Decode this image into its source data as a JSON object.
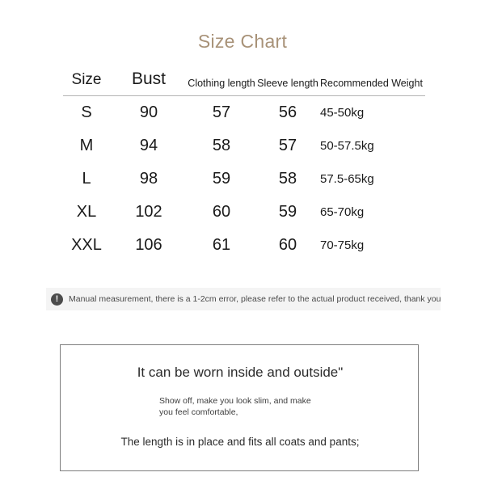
{
  "title": "Size Chart",
  "accent_color": "#a89278",
  "table": {
    "headers": {
      "size": "Size",
      "bust": "Bust",
      "clothing_length": "Clothing length",
      "sleeve_length": "Sleeve length",
      "recommended_weight": "Recommended Weight"
    },
    "rows": [
      {
        "size": "S",
        "bust": "90",
        "clothing_length": "57",
        "sleeve_length": "56",
        "recommended_weight": "45-50kg"
      },
      {
        "size": "M",
        "bust": "94",
        "clothing_length": "58",
        "sleeve_length": "57",
        "recommended_weight": "50-57.5kg"
      },
      {
        "size": "L",
        "bust": "98",
        "clothing_length": "59",
        "sleeve_length": "58",
        "recommended_weight": "57.5-65kg"
      },
      {
        "size": "XL",
        "bust": "102",
        "clothing_length": "60",
        "sleeve_length": "59",
        "recommended_weight": "65-70kg"
      },
      {
        "size": "XXL",
        "bust": "106",
        "clothing_length": "61",
        "sleeve_length": "60",
        "recommended_weight": "70-75kg"
      }
    ]
  },
  "notice": {
    "icon": "exclamation-circle-icon",
    "icon_glyph": "!",
    "text": "Manual measurement, there is a 1-2cm error, please refer to the actual product received, thank you"
  },
  "promo": {
    "headline": "It can be worn inside and outside\"",
    "subtext_line1": "Show off, make you look slim, and make",
    "subtext_line2": "you feel comfortable,",
    "footer": "The length is in place and fits all coats and pants;"
  }
}
